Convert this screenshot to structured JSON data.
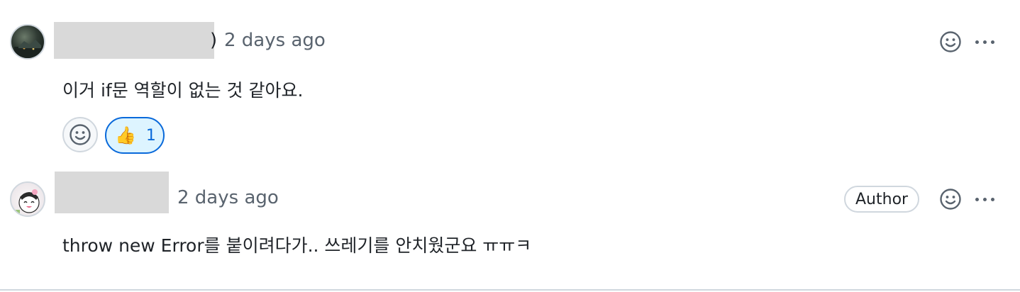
{
  "comments": [
    {
      "author_tail": ")",
      "timestamp": "2 days ago",
      "body": "이거 if문 역할이 없는 것 같아요.",
      "reactions": [
        {
          "emoji": "👍",
          "count": "1"
        }
      ]
    },
    {
      "author_tail": "",
      "timestamp": "2 days ago",
      "badge": "Author",
      "body": "throw new Error를 붙이려다가.. 쓰레기를 안치웠군요 ㅠㅠㅋ"
    }
  ],
  "icons": {
    "add_reaction": "smiley-icon",
    "more": "kebab-horizontal-icon"
  },
  "colors": {
    "text_primary": "#1f2328",
    "text_muted": "#59636e",
    "reaction_accent": "#0969da",
    "reaction_bg": "#ddf4ff",
    "border": "#d0d7de"
  }
}
